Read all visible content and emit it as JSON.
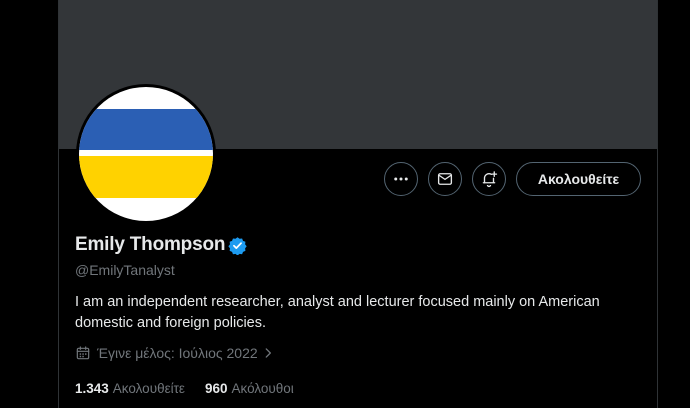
{
  "profile": {
    "display_name": "Emily Thompson",
    "handle": "@EmilyTanalyst",
    "verified": true,
    "bio": "I am an independent researcher, analyst and lecturer focused mainly on American domestic and foreign policies.",
    "joined": "Έγινε μέλος: Ιούλιος 2022",
    "avatar": {
      "type": "flag",
      "colors": [
        "#ffffff",
        "#2b5fb4",
        "#ffffff",
        "#ffd200",
        "#ffffff"
      ]
    }
  },
  "actions": {
    "more_icon": "more-icon",
    "message_icon": "mail-icon",
    "notify_icon": "bell-plus-icon",
    "follow_label": "Ακολουθείτε"
  },
  "stats": {
    "following_count": "1.343",
    "following_label": "Ακολουθείτε",
    "followers_count": "960",
    "followers_label": "Ακόλουθοι"
  },
  "colors": {
    "background": "#000000",
    "banner": "#333639",
    "text_primary": "#e7e9ea",
    "text_secondary": "#71767b",
    "border": "#536471",
    "verified": "#1d9bf0"
  }
}
